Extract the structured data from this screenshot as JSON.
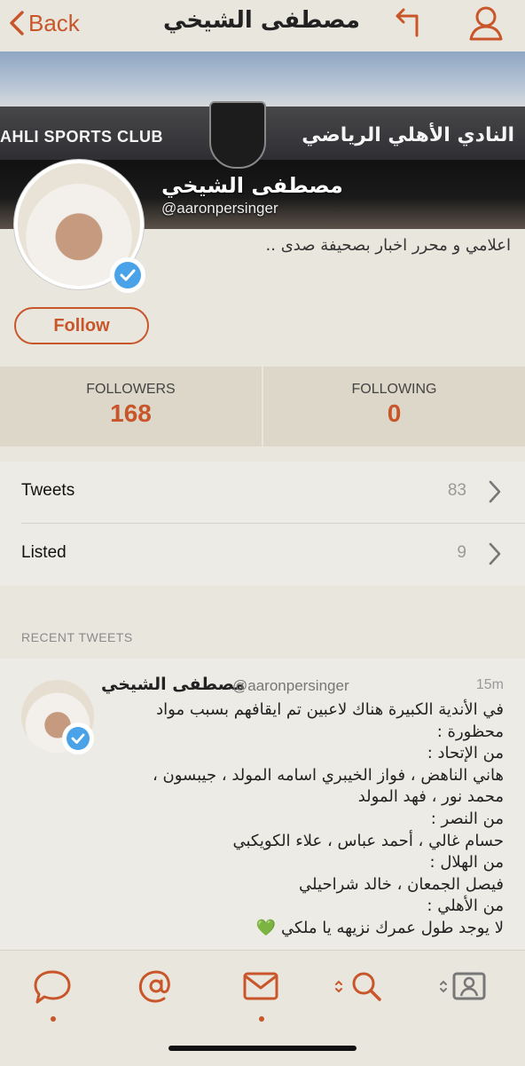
{
  "nav": {
    "back_label": "Back",
    "title": "مصطفى الشيخي"
  },
  "banner": {
    "sign_en": "AHLI SPORTS CLUB",
    "sign_ar": "النادي الأهلي الرياضي"
  },
  "profile": {
    "name": "مصطفى الشيخي",
    "handle": "@aaronpersinger",
    "bio": "اعلامي و محرر اخبار بصحيفة صدى ..",
    "follow_label": "Follow",
    "verified": true
  },
  "stats": {
    "followers_label": "FOLLOWERS",
    "followers_value": "168",
    "following_label": "FOLLOWING",
    "following_value": "0"
  },
  "rows": [
    {
      "label": "Tweets",
      "count": "83"
    },
    {
      "label": "Listed",
      "count": "9"
    }
  ],
  "recent_header": "RECENT TWEETS",
  "tweet": {
    "name": "مصطفى الشيخي",
    "handle": "@aaronpersinger",
    "time": "15m",
    "lines": [
      "في الأندية الكبيرة هناك لاعبين تم ايقافهم بسبب مواد",
      "محظورة :",
      "من الإتحاد :",
      "هاني الناهض ، فواز الخيبري اسامه المولد ، جيبسون ،",
      "محمد نور ، فهد المولد",
      "من النصر :",
      "حسام غالي ، أحمد عباس ، علاء الكويكبي",
      "من الهلال :",
      "فيصل الجمعان ، خالد شراحيلي",
      "من الأهلي :",
      "لا يوجد طول عمرك نزيهه يا ملكي 💚"
    ]
  },
  "tabbar": {
    "items": [
      "chat-bubble-icon",
      "at-sign-icon",
      "mail-icon",
      "search-icon",
      "profile-card-icon"
    ]
  },
  "colors": {
    "accent": "#c9562b",
    "background": "#e9e6dd",
    "stats_bg": "#ddd7c9",
    "verified_blue": "#4aa3e8"
  }
}
